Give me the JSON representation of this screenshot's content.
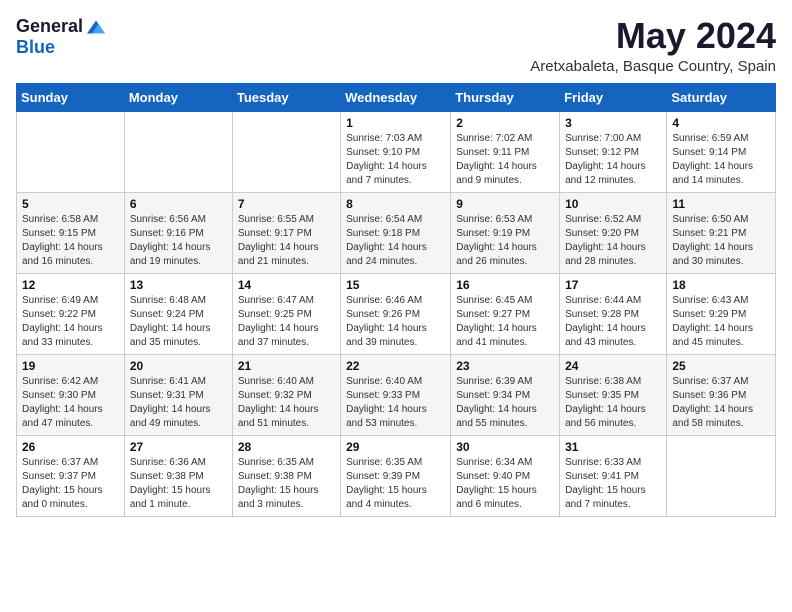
{
  "logo": {
    "general": "General",
    "blue": "Blue"
  },
  "header": {
    "title": "May 2024",
    "subtitle": "Aretxabaleta, Basque Country, Spain"
  },
  "weekdays": [
    "Sunday",
    "Monday",
    "Tuesday",
    "Wednesday",
    "Thursday",
    "Friday",
    "Saturday"
  ],
  "weeks": [
    [
      {
        "day": "",
        "info": ""
      },
      {
        "day": "",
        "info": ""
      },
      {
        "day": "",
        "info": ""
      },
      {
        "day": "1",
        "info": "Sunrise: 7:03 AM\nSunset: 9:10 PM\nDaylight: 14 hours\nand 7 minutes."
      },
      {
        "day": "2",
        "info": "Sunrise: 7:02 AM\nSunset: 9:11 PM\nDaylight: 14 hours\nand 9 minutes."
      },
      {
        "day": "3",
        "info": "Sunrise: 7:00 AM\nSunset: 9:12 PM\nDaylight: 14 hours\nand 12 minutes."
      },
      {
        "day": "4",
        "info": "Sunrise: 6:59 AM\nSunset: 9:14 PM\nDaylight: 14 hours\nand 14 minutes."
      }
    ],
    [
      {
        "day": "5",
        "info": "Sunrise: 6:58 AM\nSunset: 9:15 PM\nDaylight: 14 hours\nand 16 minutes."
      },
      {
        "day": "6",
        "info": "Sunrise: 6:56 AM\nSunset: 9:16 PM\nDaylight: 14 hours\nand 19 minutes."
      },
      {
        "day": "7",
        "info": "Sunrise: 6:55 AM\nSunset: 9:17 PM\nDaylight: 14 hours\nand 21 minutes."
      },
      {
        "day": "8",
        "info": "Sunrise: 6:54 AM\nSunset: 9:18 PM\nDaylight: 14 hours\nand 24 minutes."
      },
      {
        "day": "9",
        "info": "Sunrise: 6:53 AM\nSunset: 9:19 PM\nDaylight: 14 hours\nand 26 minutes."
      },
      {
        "day": "10",
        "info": "Sunrise: 6:52 AM\nSunset: 9:20 PM\nDaylight: 14 hours\nand 28 minutes."
      },
      {
        "day": "11",
        "info": "Sunrise: 6:50 AM\nSunset: 9:21 PM\nDaylight: 14 hours\nand 30 minutes."
      }
    ],
    [
      {
        "day": "12",
        "info": "Sunrise: 6:49 AM\nSunset: 9:22 PM\nDaylight: 14 hours\nand 33 minutes."
      },
      {
        "day": "13",
        "info": "Sunrise: 6:48 AM\nSunset: 9:24 PM\nDaylight: 14 hours\nand 35 minutes."
      },
      {
        "day": "14",
        "info": "Sunrise: 6:47 AM\nSunset: 9:25 PM\nDaylight: 14 hours\nand 37 minutes."
      },
      {
        "day": "15",
        "info": "Sunrise: 6:46 AM\nSunset: 9:26 PM\nDaylight: 14 hours\nand 39 minutes."
      },
      {
        "day": "16",
        "info": "Sunrise: 6:45 AM\nSunset: 9:27 PM\nDaylight: 14 hours\nand 41 minutes."
      },
      {
        "day": "17",
        "info": "Sunrise: 6:44 AM\nSunset: 9:28 PM\nDaylight: 14 hours\nand 43 minutes."
      },
      {
        "day": "18",
        "info": "Sunrise: 6:43 AM\nSunset: 9:29 PM\nDaylight: 14 hours\nand 45 minutes."
      }
    ],
    [
      {
        "day": "19",
        "info": "Sunrise: 6:42 AM\nSunset: 9:30 PM\nDaylight: 14 hours\nand 47 minutes."
      },
      {
        "day": "20",
        "info": "Sunrise: 6:41 AM\nSunset: 9:31 PM\nDaylight: 14 hours\nand 49 minutes."
      },
      {
        "day": "21",
        "info": "Sunrise: 6:40 AM\nSunset: 9:32 PM\nDaylight: 14 hours\nand 51 minutes."
      },
      {
        "day": "22",
        "info": "Sunrise: 6:40 AM\nSunset: 9:33 PM\nDaylight: 14 hours\nand 53 minutes."
      },
      {
        "day": "23",
        "info": "Sunrise: 6:39 AM\nSunset: 9:34 PM\nDaylight: 14 hours\nand 55 minutes."
      },
      {
        "day": "24",
        "info": "Sunrise: 6:38 AM\nSunset: 9:35 PM\nDaylight: 14 hours\nand 56 minutes."
      },
      {
        "day": "25",
        "info": "Sunrise: 6:37 AM\nSunset: 9:36 PM\nDaylight: 14 hours\nand 58 minutes."
      }
    ],
    [
      {
        "day": "26",
        "info": "Sunrise: 6:37 AM\nSunset: 9:37 PM\nDaylight: 15 hours\nand 0 minutes."
      },
      {
        "day": "27",
        "info": "Sunrise: 6:36 AM\nSunset: 9:38 PM\nDaylight: 15 hours\nand 1 minute."
      },
      {
        "day": "28",
        "info": "Sunrise: 6:35 AM\nSunset: 9:38 PM\nDaylight: 15 hours\nand 3 minutes."
      },
      {
        "day": "29",
        "info": "Sunrise: 6:35 AM\nSunset: 9:39 PM\nDaylight: 15 hours\nand 4 minutes."
      },
      {
        "day": "30",
        "info": "Sunrise: 6:34 AM\nSunset: 9:40 PM\nDaylight: 15 hours\nand 6 minutes."
      },
      {
        "day": "31",
        "info": "Sunrise: 6:33 AM\nSunset: 9:41 PM\nDaylight: 15 hours\nand 7 minutes."
      },
      {
        "day": "",
        "info": ""
      }
    ]
  ]
}
